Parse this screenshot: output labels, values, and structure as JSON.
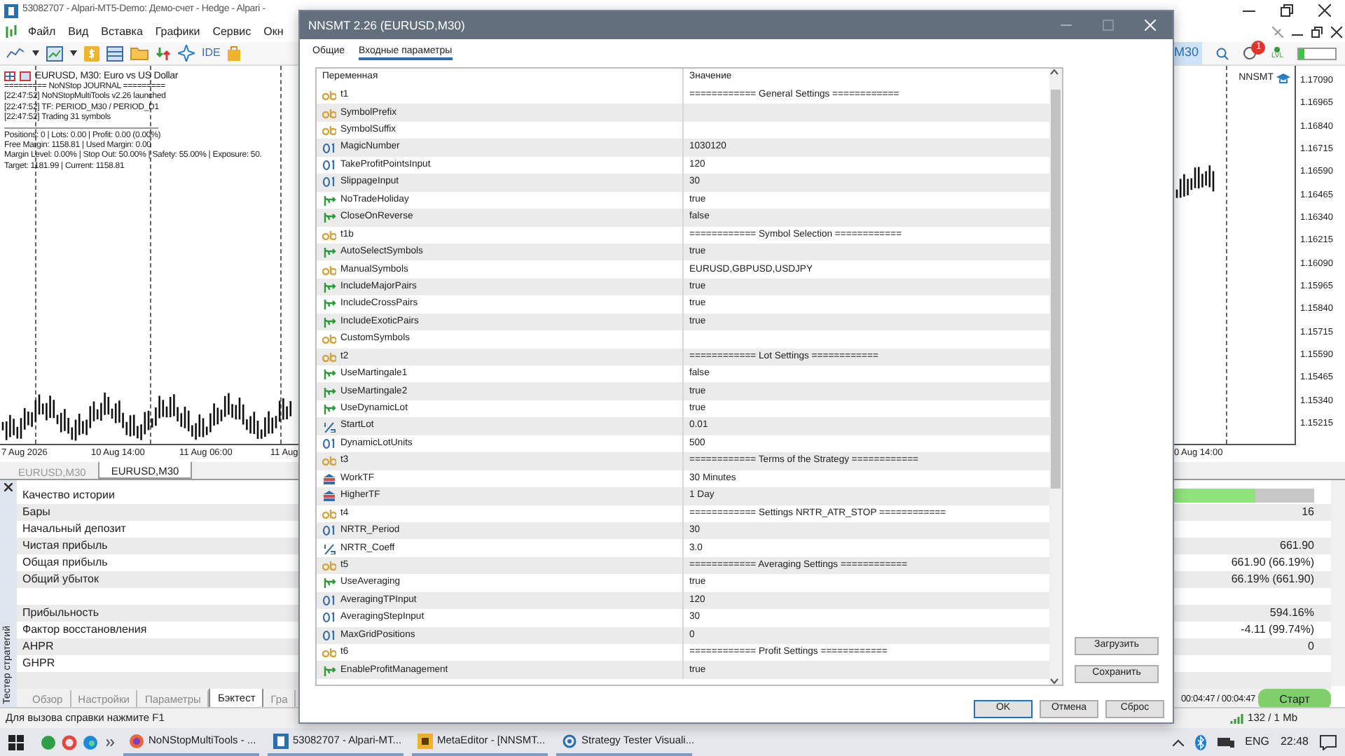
{
  "app_window": {
    "title": "53082707 - Alpari-MT5-Demo: Демо-счет - Hedge - Alpari -",
    "menu": [
      "Файл",
      "Вид",
      "Вставка",
      "Графики",
      "Сервис",
      "Окн"
    ]
  },
  "toolbar": {
    "ide_label": "IDE",
    "timeframe": "M30",
    "notification_count": "1",
    "lvl_label": "LVL",
    "meter": {
      "level": 0.15
    }
  },
  "chart": {
    "symbol_line": "EURUSD, M30:  Euro vs US Dollar",
    "journal": [
      "========= NoNStop JOURNAL =========",
      "[22:47:52] NoNStopMultiTools v2.26 launched",
      "[22:47:52] TF: PERIOD_M30 / PERIOD_D1",
      "[22:47:52] Trading 31 symbols"
    ],
    "stats": [
      "Positions: 0 | Lots: 0.00 | Profit: 0.00 (0.00%)",
      "Free Margin: 1158.81 | Used Margin: 0.00",
      "Margin Level: 0.00% | Stop Out: 50.00% | Safety: 55.00% | Exposure: 50.",
      "Target: 1181.99 | Current: 1158.81"
    ],
    "expert_label": "NNSMT",
    "price_axis": [
      "1.17090",
      "1.16965",
      "1.16840",
      "1.16715",
      "1.16590",
      "1.16465",
      "1.16340",
      "1.16215",
      "1.16090",
      "1.15965",
      "1.15840",
      "1.15715",
      "1.15590",
      "1.15465",
      "1.15340",
      "1.15215"
    ],
    "time_axis": [
      "7 Aug 2026",
      "10 Aug 14:00",
      "11 Aug 06:00",
      "11 Aug",
      "0 Aug 14:00"
    ]
  },
  "chart_tabs": [
    {
      "label": "EURUSD,M30",
      "selected": false
    },
    {
      "label": "EURUSD,M30",
      "selected": true
    }
  ],
  "tester": {
    "side_label": "Тестер стратегий",
    "rows": [
      {
        "kind": "bar",
        "label": "Качество истории",
        "level": 0.94
      },
      {
        "kind": "value",
        "label": "Бары",
        "value": "16"
      },
      {
        "kind": "value",
        "label": "Начальный депозит"
      },
      {
        "kind": "value",
        "label": "Чистая прибыль",
        "value": "661.90"
      },
      {
        "kind": "value",
        "label": "Общая прибыль",
        "value": "661.90 (66.19%)"
      },
      {
        "kind": "value",
        "label": "Общий убыток",
        "value": "66.19% (661.90)"
      },
      {
        "kind": "blank"
      },
      {
        "kind": "value",
        "label": "Прибыльность",
        "value": "594.16%"
      },
      {
        "kind": "value",
        "label": "Фактор восстановления",
        "value": "-4.11 (99.74%)"
      },
      {
        "kind": "value",
        "label": "AHPR",
        "value": "0"
      },
      {
        "kind": "value",
        "label": "GHPR"
      },
      {
        "kind": "blank"
      }
    ],
    "tabs": [
      {
        "label": "Обзор",
        "selected": false
      },
      {
        "label": "Настройки",
        "selected": false
      },
      {
        "label": "Параметры",
        "selected": false
      },
      {
        "label": "Бэктест",
        "selected": true
      },
      {
        "label": "Гра",
        "selected": false
      }
    ],
    "timer": "00:04:47 / 00:04:47",
    "start_button": "Старт"
  },
  "status_bar": {
    "help": "Для вызова справки нажмите F1",
    "traffic": "132 / 1 Mb"
  },
  "taskbar": {
    "tasks": [
      {
        "kind": "browser",
        "label": "NoNStopMultiTools - ..."
      },
      {
        "kind": "terminal",
        "label": "53082707 - Alpari-MT..."
      },
      {
        "kind": "editor",
        "label": "MetaEditor - [NNSMT..."
      },
      {
        "kind": "tester",
        "label": "Strategy Tester Visuali..."
      }
    ],
    "language": "ENG",
    "clock": "22:48"
  },
  "dialog": {
    "title": "NNSMT 2.26 (EURUSD,M30)",
    "tabs": [
      {
        "label": "Общие",
        "selected": false
      },
      {
        "label": "Входные параметры",
        "selected": true
      }
    ],
    "columns": [
      "Переменная",
      "Значение"
    ],
    "params": [
      {
        "kind": "string",
        "name": "t1",
        "value": "============ General Settings ============"
      },
      {
        "kind": "string",
        "name": "SymbolPrefix"
      },
      {
        "kind": "string",
        "name": "SymbolSuffix"
      },
      {
        "kind": "int",
        "name": "MagicNumber",
        "value": "1030120"
      },
      {
        "kind": "int",
        "name": "TakeProfitPointsInput",
        "value": "120"
      },
      {
        "kind": "int",
        "name": "SlippageInput",
        "value": "30"
      },
      {
        "kind": "bool",
        "name": "NoTradeHoliday",
        "value": "true"
      },
      {
        "kind": "bool",
        "name": "CloseOnReverse",
        "value": "false"
      },
      {
        "kind": "string",
        "name": "t1b",
        "value": "============ Symbol Selection ============"
      },
      {
        "kind": "bool",
        "name": "AutoSelectSymbols",
        "value": "true"
      },
      {
        "kind": "string",
        "name": "ManualSymbols",
        "value": "EURUSD,GBPUSD,USDJPY"
      },
      {
        "kind": "bool",
        "name": "IncludeMajorPairs",
        "value": "true"
      },
      {
        "kind": "bool",
        "name": "IncludeCrossPairs",
        "value": "true"
      },
      {
        "kind": "bool",
        "name": "IncludeExoticPairs",
        "value": "true"
      },
      {
        "kind": "string",
        "name": "CustomSymbols"
      },
      {
        "kind": "string",
        "name": "t2",
        "value": "============ Lot Settings ============"
      },
      {
        "kind": "bool",
        "name": "UseMartingale1",
        "value": "false"
      },
      {
        "kind": "bool",
        "name": "UseMartingale2",
        "value": "true"
      },
      {
        "kind": "bool",
        "name": "UseDynamicLot",
        "value": "true"
      },
      {
        "kind": "double",
        "name": "StartLot",
        "value": "0.01"
      },
      {
        "kind": "int",
        "name": "DynamicLotUnits",
        "value": "500"
      },
      {
        "kind": "string",
        "name": "t3",
        "value": "============ Terms of the Strategy ============"
      },
      {
        "kind": "enum",
        "name": "WorkTF",
        "value": "30 Minutes"
      },
      {
        "kind": "enum",
        "name": "HigherTF",
        "value": "1 Day"
      },
      {
        "kind": "string",
        "name": "t4",
        "value": "============ Settings NRTR_ATR_STOP ============"
      },
      {
        "kind": "int",
        "name": "NRTR_Period",
        "value": "30"
      },
      {
        "kind": "double",
        "name": "NRTR_Coeff",
        "value": "3.0"
      },
      {
        "kind": "string",
        "name": "t5",
        "value": "============ Averaging Settings ============"
      },
      {
        "kind": "bool",
        "name": "UseAveraging",
        "value": "true"
      },
      {
        "kind": "int",
        "name": "AveragingTPInput",
        "value": "120"
      },
      {
        "kind": "int",
        "name": "AveragingStepInput",
        "value": "30"
      },
      {
        "kind": "int",
        "name": "MaxGridPositions",
        "value": "0"
      },
      {
        "kind": "string",
        "name": "t6",
        "value": "============ Profit Settings ============"
      },
      {
        "kind": "bool",
        "name": "EnableProfitManagement",
        "value": "true"
      }
    ],
    "side_buttons": [
      "Загрузить",
      "Сохранить"
    ],
    "buttons": [
      "OK",
      "Отмена",
      "Сброс"
    ]
  }
}
